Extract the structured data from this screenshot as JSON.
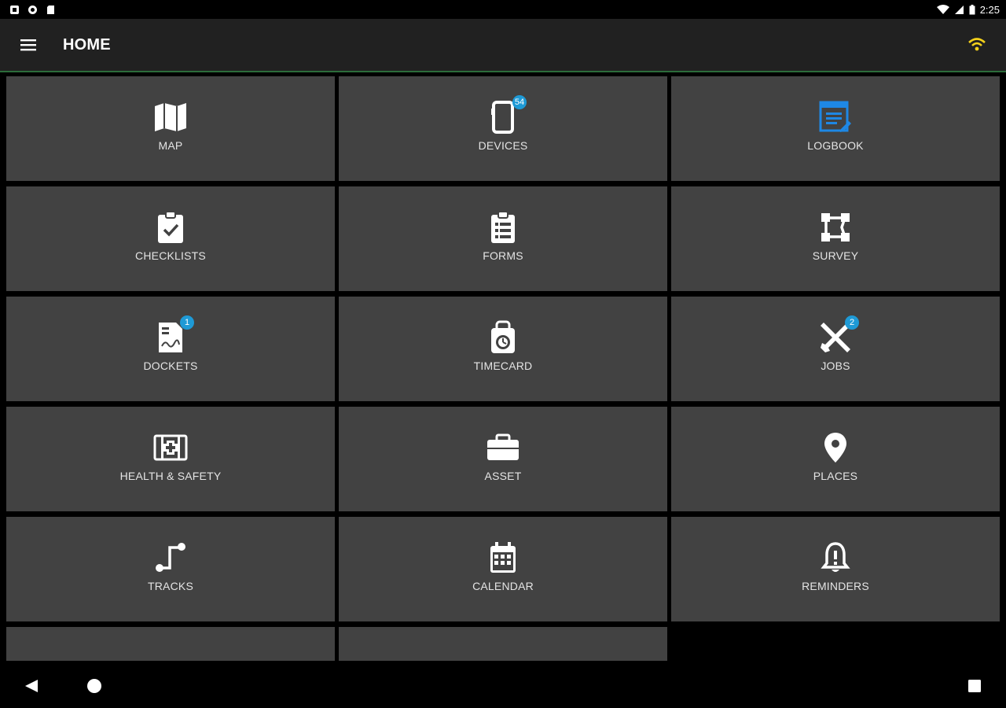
{
  "status_bar": {
    "time": "2:25",
    "left_icons": [
      "notification-icon",
      "sync-icon",
      "sd-card-icon"
    ],
    "right_icons": [
      "wifi-icon",
      "cell-signal-icon",
      "battery-icon"
    ]
  },
  "app_bar": {
    "title": "HOME",
    "menu_icon": "menu-icon",
    "connection_icon": "wifi-signal-icon",
    "connection_color": "#f4d11b"
  },
  "colors": {
    "tile_bg": "#424242",
    "badge": "#1e9ad6",
    "logbook_accent": "#1e88e5"
  },
  "tiles": [
    {
      "label": "MAP",
      "icon": "map-icon"
    },
    {
      "label": "DEVICES",
      "icon": "devices-icon",
      "badge": "54"
    },
    {
      "label": "LOGBOOK",
      "icon": "logbook-icon"
    },
    {
      "label": "CHECKLISTS",
      "icon": "checklist-icon"
    },
    {
      "label": "FORMS",
      "icon": "forms-icon"
    },
    {
      "label": "SURVEY",
      "icon": "survey-icon"
    },
    {
      "label": "DOCKETS",
      "icon": "dockets-icon",
      "badge": "1"
    },
    {
      "label": "TIMECARD",
      "icon": "timecard-icon"
    },
    {
      "label": "JOBS",
      "icon": "jobs-icon",
      "badge": "2"
    },
    {
      "label": "HEALTH & SAFETY",
      "icon": "first-aid-icon"
    },
    {
      "label": "ASSET",
      "icon": "briefcase-icon"
    },
    {
      "label": "PLACES",
      "icon": "place-marker-icon"
    },
    {
      "label": "TRACKS",
      "icon": "tracks-icon"
    },
    {
      "label": "CALENDAR",
      "icon": "calendar-icon"
    },
    {
      "label": "REMINDERS",
      "icon": "bell-icon"
    }
  ]
}
